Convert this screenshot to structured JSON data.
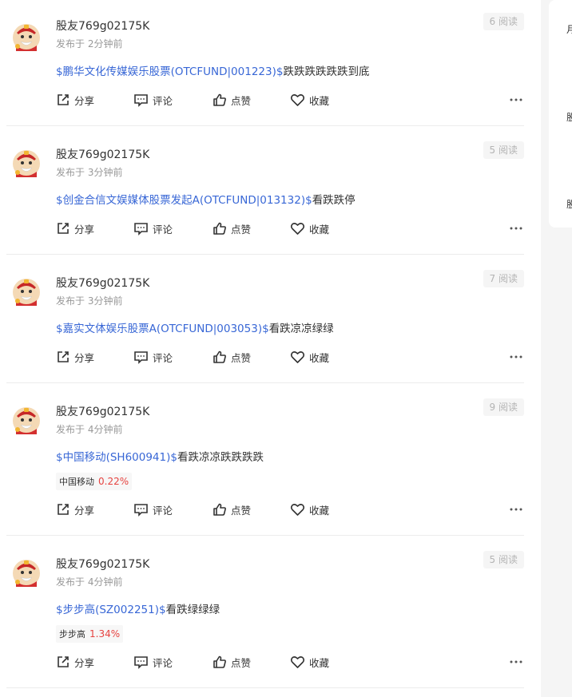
{
  "labels": {
    "share": "分享",
    "comment": "评论",
    "like": "点赞",
    "favorite": "收藏"
  },
  "posts": [
    {
      "username": "股友769g02175K",
      "time": "发布于 2分钟前",
      "reads": "6 阅读",
      "stock": "$鹏华文化传媒娱乐股票(OTCFUND|001223)$",
      "text": "跌跌跌跌跌跌到底"
    },
    {
      "username": "股友769g02175K",
      "time": "发布于 3分钟前",
      "reads": "5 阅读",
      "stock": "$创金合信文娱媒体股票发起A(OTCFUND|013132)$",
      "text": "看跌跌停"
    },
    {
      "username": "股友769g02175K",
      "time": "发布于 3分钟前",
      "reads": "7 阅读",
      "stock": "$嘉实文体娱乐股票A(OTCFUND|003053)$",
      "text": "看跌凉凉绿绿"
    },
    {
      "username": "股友769g02175K",
      "time": "发布于 4分钟前",
      "reads": "9 阅读",
      "stock": "$中国移动(SH600941)$",
      "text": "看跌凉凉跌跌跌跌",
      "quote_name": "中国移动",
      "quote_change": "0.22%"
    },
    {
      "username": "股友769g02175K",
      "time": "发布于 4分钟前",
      "reads": "5 阅读",
      "stock": "$步步高(SZ002251)$",
      "text": "看跌绿绿绿",
      "quote_name": "步步高",
      "quote_change": "1.34%"
    }
  ],
  "sidebar": {
    "fragments": [
      "月",
      "股",
      "股"
    ]
  },
  "colors": {
    "link": "#3867d6",
    "quote_change": "#e64340",
    "muted": "#999999"
  }
}
